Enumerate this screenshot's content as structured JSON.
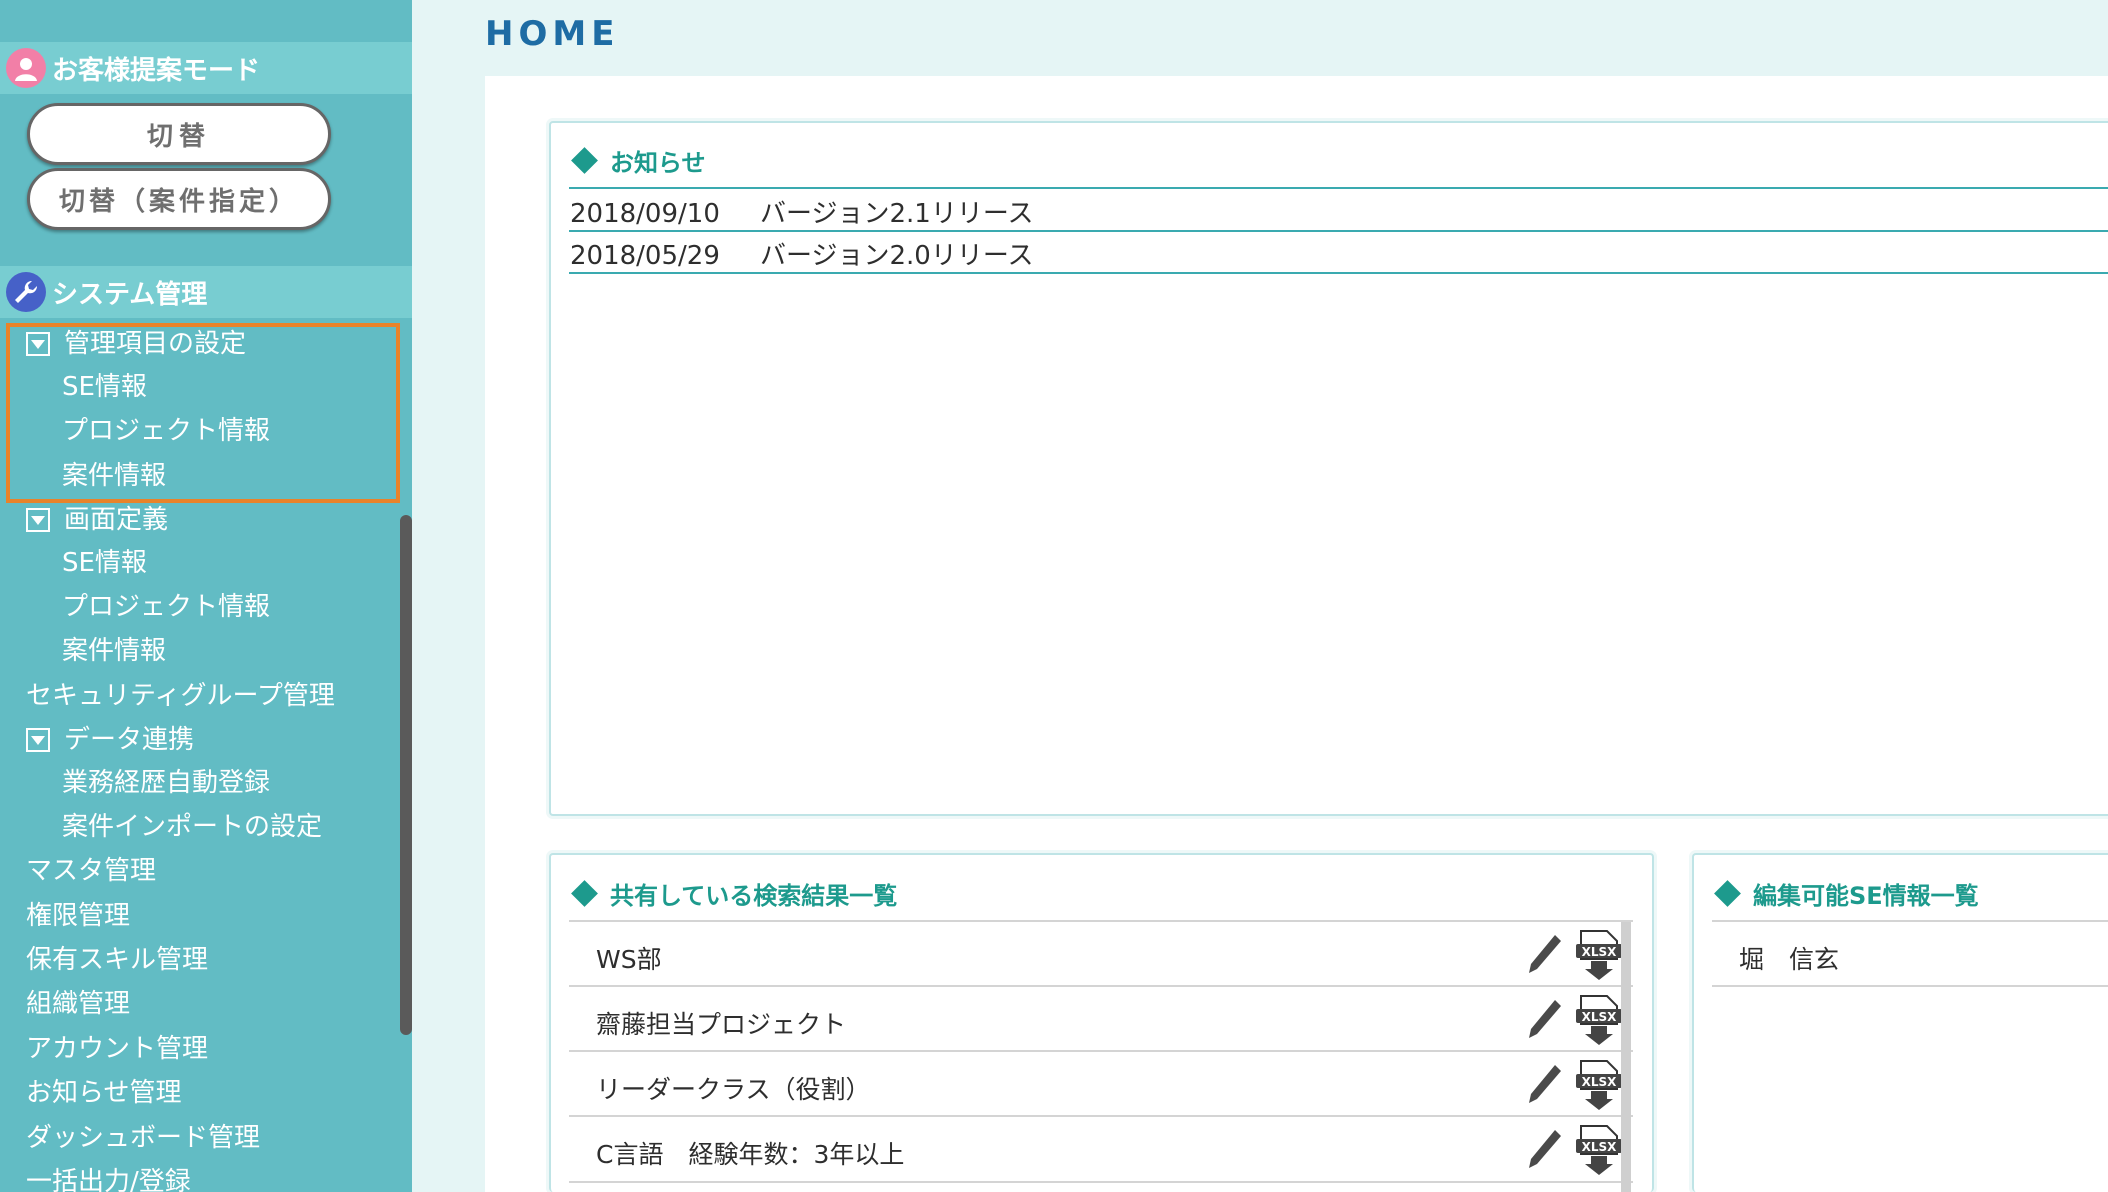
{
  "page": {
    "title": "HOME"
  },
  "sidebar": {
    "customer_mode": {
      "header": "お客様提案モード",
      "icon": "customer-icon",
      "buttons": [
        "切替",
        "切替（案件指定）"
      ]
    },
    "system": {
      "header": "システム管理",
      "icon": "wrench-icon",
      "groups": [
        {
          "label": "管理項目の設定",
          "items": [
            "SE情報",
            "プロジェクト情報",
            "案件情報"
          ]
        },
        {
          "label": "画面定義",
          "items": [
            "SE情報",
            "プロジェクト情報",
            "案件情報"
          ]
        }
      ],
      "security_group": "セキュリティグループ管理",
      "data_link": {
        "label": "データ連携",
        "items": [
          "業務経歴自動登録",
          "案件インポートの設定"
        ]
      },
      "items": [
        "マスタ管理",
        "権限管理",
        "保有スキル管理",
        "組織管理",
        "アカウント管理",
        "お知らせ管理",
        "ダッシュボード管理",
        "一括出力/登録"
      ]
    }
  },
  "news": {
    "title": "お知らせ",
    "rows": [
      {
        "date": "2018/09/10",
        "text": "バージョン2.1リリース"
      },
      {
        "date": "2018/05/29",
        "text": "バージョン2.0リリース"
      }
    ]
  },
  "shared_searches": {
    "title": "共有している検索結果一覧",
    "rows": [
      "WS部",
      "齋藤担当プロジェクト",
      "リーダークラス（役割）",
      "C言語　経験年数：3年以上"
    ],
    "xlsx_label": "XLSX"
  },
  "editable_se": {
    "title": "編集可能SE情報一覧",
    "rows": [
      "堀　信玄"
    ]
  },
  "colors": {
    "sidebar": "#62bcc4",
    "section_header": "#78cdd1",
    "accent": "#1d9a8d",
    "title": "#1e6ca4",
    "highlight": "#e8832a"
  }
}
